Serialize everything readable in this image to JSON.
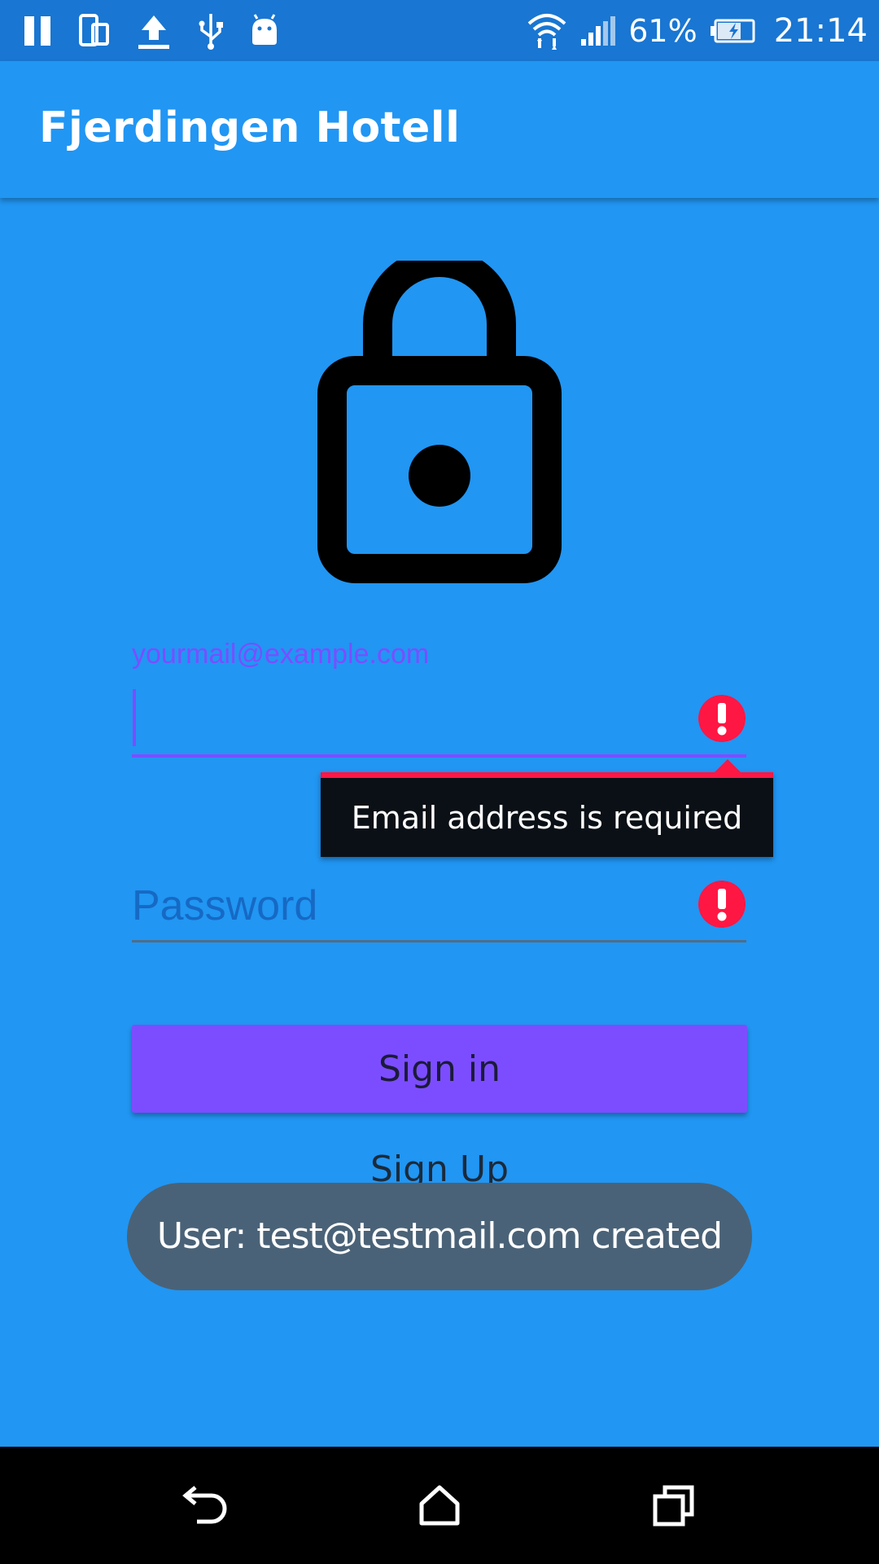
{
  "status_bar": {
    "battery_percent": "61%",
    "time": "21:14"
  },
  "app_bar": {
    "title": "Fjerdingen Hotell"
  },
  "login_form": {
    "email": {
      "label": "yourmail@example.com",
      "value": "",
      "error": "Email address is required"
    },
    "password": {
      "placeholder": "Password",
      "value": ""
    },
    "signin_label": "Sign in",
    "signup_label": "Sign Up"
  },
  "toast": {
    "message": "User: test@testmail.com created"
  },
  "colors": {
    "background": "#2196F3",
    "status_bar": "#1976D2",
    "accent": "#7C4DFF",
    "error": "#FF1744",
    "toast": "#4A6277"
  },
  "icons": [
    "pause-icon",
    "screen-rotate-icon",
    "upload-icon",
    "usb-icon",
    "android-icon",
    "wifi-icon",
    "signal-icon",
    "battery-icon",
    "lock-icon",
    "error-icon",
    "back-icon",
    "home-icon",
    "recent-apps-icon"
  ]
}
